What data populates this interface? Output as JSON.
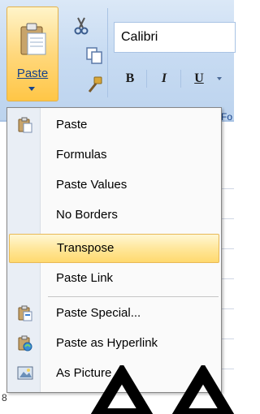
{
  "ribbon": {
    "paste_label": "Paste",
    "font_name": "Calibri",
    "bold_label": "B",
    "italic_label": "I",
    "underline_label": "U",
    "side_fragment": "Fo"
  },
  "menu": {
    "items": [
      {
        "label": "Paste",
        "icon": "clipboard-paste-icon",
        "highlighted": false
      },
      {
        "label": "Formulas",
        "icon": "",
        "highlighted": false
      },
      {
        "label": "Paste Values",
        "icon": "",
        "highlighted": false
      },
      {
        "label": "No Borders",
        "icon": "",
        "highlighted": false
      },
      {
        "label": "Transpose",
        "icon": "",
        "highlighted": true
      },
      {
        "label": "Paste Link",
        "icon": "",
        "highlighted": false
      },
      {
        "label": "Paste Special...",
        "icon": "paste-special-icon",
        "highlighted": false
      },
      {
        "label": "Paste as Hyperlink",
        "icon": "paste-hyperlink-icon",
        "highlighted": false
      },
      {
        "label": "As Picture",
        "icon": "picture-icon",
        "highlighted": false
      }
    ]
  },
  "sheet": {
    "row_number": "8"
  },
  "colors": {
    "ribbon": "#c7dbf2",
    "highlight": "#ffe79b",
    "accent_text": "#15428b"
  }
}
